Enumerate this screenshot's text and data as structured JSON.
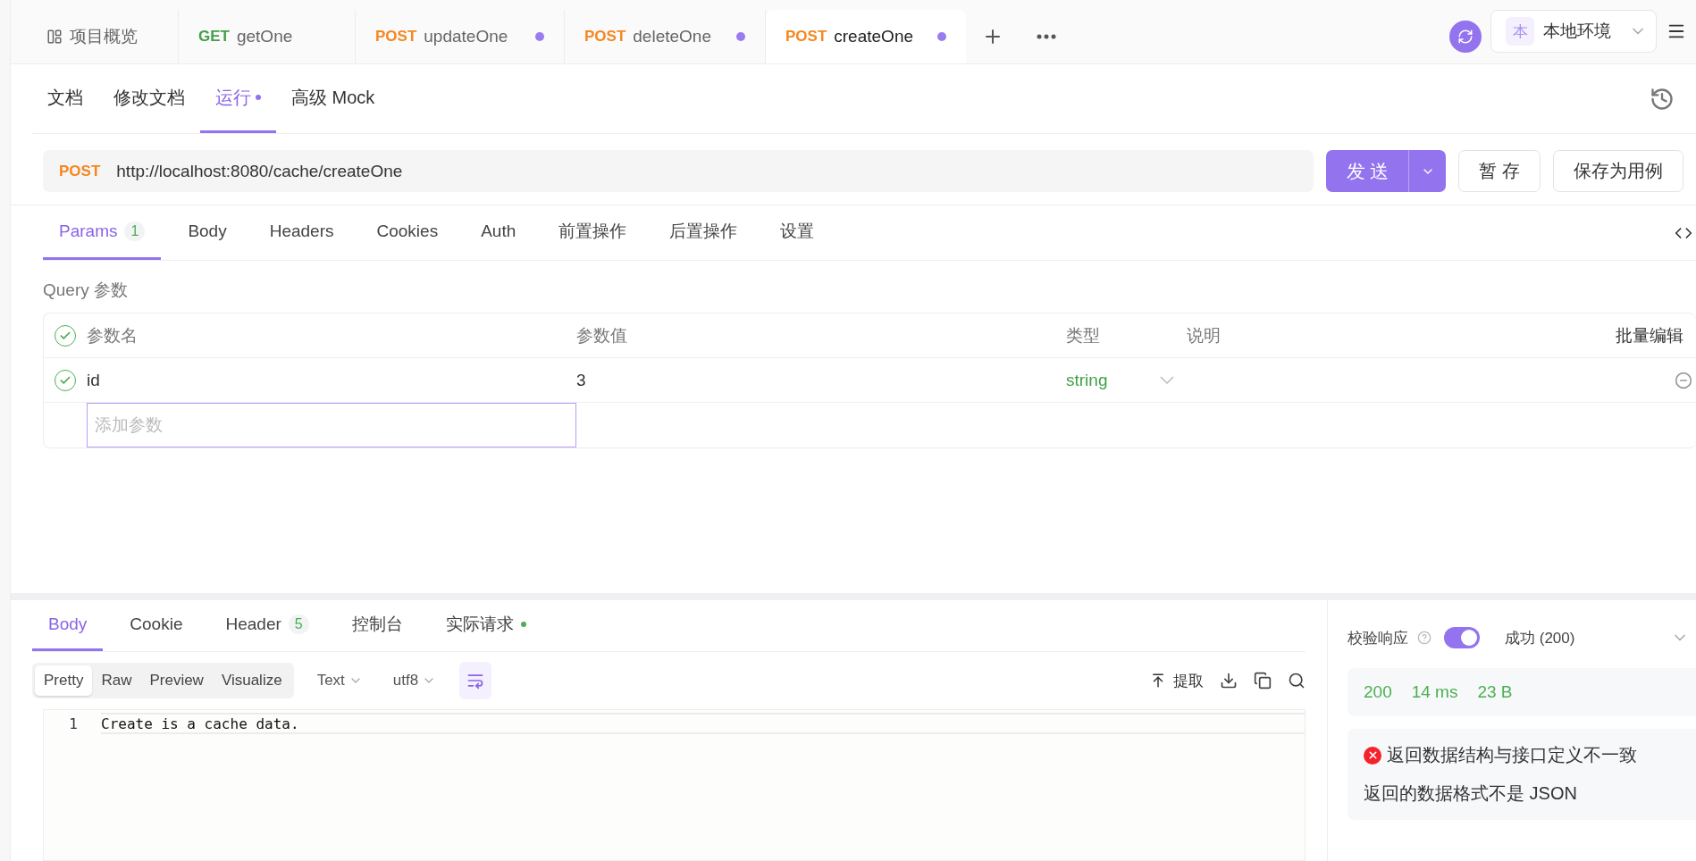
{
  "top_tabs": [
    {
      "kind": "overview",
      "label": "项目概览",
      "selected": false,
      "modified": false
    },
    {
      "kind": "api",
      "method": "GET",
      "label": "getOne",
      "selected": false,
      "modified": false
    },
    {
      "kind": "api",
      "method": "POST",
      "label": "updateOne",
      "selected": false,
      "modified": true
    },
    {
      "kind": "api",
      "method": "POST",
      "label": "deleteOne",
      "selected": false,
      "modified": true
    },
    {
      "kind": "api",
      "method": "POST",
      "label": "createOne",
      "selected": true,
      "modified": true
    }
  ],
  "environment": {
    "badge": "本",
    "label": "本地环境"
  },
  "request_tabs": [
    {
      "label": "文档",
      "selected": false,
      "dot": false
    },
    {
      "label": "修改文档",
      "selected": false,
      "dot": false
    },
    {
      "label": "运行",
      "selected": true,
      "dot": true
    },
    {
      "label": "高级 Mock",
      "selected": false,
      "dot": false
    }
  ],
  "url_bar": {
    "method": "POST",
    "url": "http://localhost:8080/cache/createOne"
  },
  "send_button": "发 送",
  "save_draft_button": "暂 存",
  "save_case_button": "保存为用例",
  "param_tabs": [
    {
      "label": "Params",
      "count": "1",
      "selected": true
    },
    {
      "label": "Body",
      "selected": false
    },
    {
      "label": "Headers",
      "selected": false
    },
    {
      "label": "Cookies",
      "selected": false
    },
    {
      "label": "Auth",
      "selected": false
    },
    {
      "label": "前置操作",
      "selected": false
    },
    {
      "label": "后置操作",
      "selected": false
    },
    {
      "label": "设置",
      "selected": false
    }
  ],
  "query_title": "Query 参数",
  "params_table": {
    "columns": [
      "参数名",
      "参数值",
      "类型",
      "说明"
    ],
    "batch_edit": "批量编辑",
    "all_checked": true,
    "rows": [
      {
        "checked": true,
        "name": "id",
        "value": "3",
        "type": "string"
      }
    ],
    "new_row": {
      "placeholder": "添加参数"
    }
  },
  "response_tabs": [
    {
      "label": "Body",
      "selected": true,
      "dot": false
    },
    {
      "label": "Cookie",
      "selected": false,
      "dot": false
    },
    {
      "label": "Header",
      "count": "5",
      "selected": false,
      "dot": false
    },
    {
      "label": "控制台",
      "selected": false,
      "dot": false
    },
    {
      "label": "实际请求",
      "selected": false,
      "dot": true
    }
  ],
  "view_modes": [
    {
      "label": "Pretty",
      "selected": true
    },
    {
      "label": "Raw",
      "selected": false
    },
    {
      "label": "Preview",
      "selected": false
    },
    {
      "label": "Visualize",
      "selected": false
    }
  ],
  "format_select": "Text",
  "encoding_select": "utf8",
  "wrap_on": true,
  "extract_button": "提取",
  "editor": {
    "lines": [
      {
        "number": "1",
        "text": "Create is a cache data."
      }
    ]
  },
  "validation": {
    "label": "校验响应",
    "on": true,
    "result": "成功 (200)",
    "stats": [
      "200",
      "14 ms",
      "23 B"
    ],
    "error_title": "返回数据结构与接口定义不一致",
    "error_detail": "返回的数据格式不是 JSON"
  }
}
